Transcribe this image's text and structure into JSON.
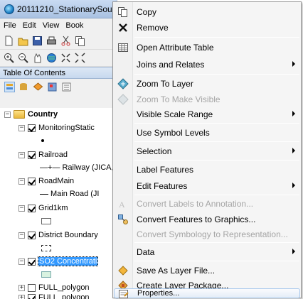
{
  "window": {
    "title": "20111210_StationarySou"
  },
  "menubar": [
    "File",
    "Edit",
    "View",
    "Book"
  ],
  "toc": {
    "header": "Table Of Contents",
    "group": "Country",
    "layers": [
      {
        "name": "MonitoringStatic",
        "checked": true,
        "legend": "point"
      },
      {
        "name": "Railroad",
        "checked": true,
        "legend": "Railway (JICA,"
      },
      {
        "name": "RoadMain",
        "checked": true,
        "legend": "Main Road (JI"
      },
      {
        "name": "Grid1km",
        "checked": true,
        "legend": "box"
      },
      {
        "name": "District Boundary",
        "checked": true,
        "legend": "box"
      },
      {
        "name": "SO2 Concentrati",
        "checked": true,
        "legend": "box",
        "selected": true
      },
      {
        "name": "FULL_polygon",
        "checked": false
      },
      {
        "name": "FULL_polygon",
        "checked": true
      }
    ]
  },
  "context_menu": {
    "items": [
      {
        "label": "Copy",
        "icon": "copy-icon"
      },
      {
        "label": "Remove",
        "icon": "remove-icon"
      },
      {
        "label": "Open Attribute Table",
        "icon": "table-icon"
      },
      {
        "label": "Joins and Relates",
        "submenu": true
      },
      {
        "label": "Zoom To Layer",
        "icon": "zoom-to-layer-icon"
      },
      {
        "label": "Zoom To Make Visible",
        "disabled": true,
        "icon": "zoom-visible-icon"
      },
      {
        "label": "Visible Scale Range",
        "submenu": true
      },
      {
        "label": "Use Symbol Levels"
      },
      {
        "label": "Selection",
        "submenu": true
      },
      {
        "label": "Label Features"
      },
      {
        "label": "Edit Features",
        "submenu": true
      },
      {
        "label": "Convert Labels to Annotation...",
        "disabled": true,
        "icon": "convert-labels-icon"
      },
      {
        "label": "Convert Features to Graphics...",
        "icon": "convert-graphics-icon"
      },
      {
        "label": "Convert Symbology to Representation...",
        "disabled": true
      },
      {
        "label": "Data",
        "submenu": true
      },
      {
        "label": "Save As Layer File...",
        "icon": "save-layer-icon"
      },
      {
        "label": "Create Layer Package...",
        "icon": "layer-package-icon"
      },
      {
        "label": "Properties...",
        "icon": "properties-icon",
        "highlighted": true
      }
    ]
  },
  "colors": {
    "selection": "#3399ff",
    "menu_highlight_border": "#a8c8ec",
    "disabled_text": "#a5a5a5"
  }
}
